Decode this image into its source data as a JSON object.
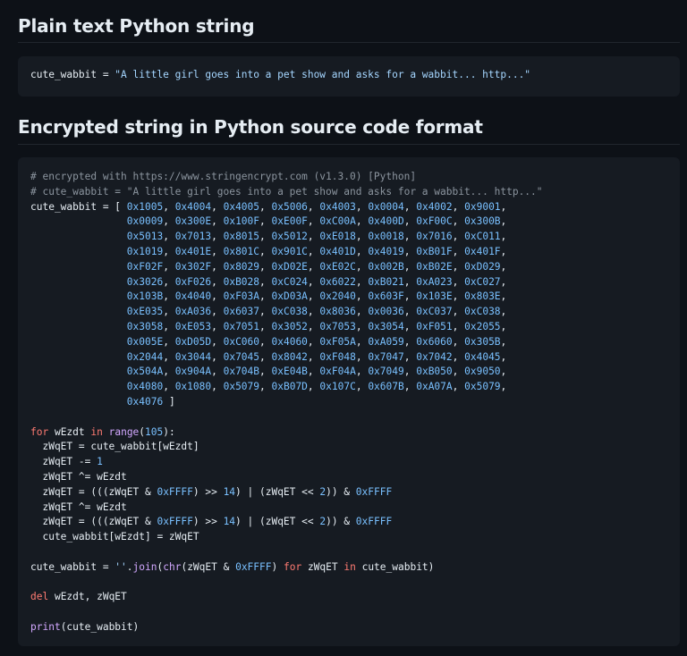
{
  "sections": [
    {
      "title": "Plain text Python string",
      "code_lines": [
        [
          {
            "t": "cute_wabbit = "
          },
          {
            "t": "\"A little girl goes into a pet show and asks for a wabbit... http...\"",
            "c": "s"
          }
        ]
      ]
    },
    {
      "title": "Encrypted string in Python source code format",
      "code_lines": [
        [
          {
            "t": "# encrypted with https://www.stringencrypt.com (v1.3.0) [Python]",
            "c": "c"
          }
        ],
        [
          {
            "t": "# cute_wabbit = \"A little girl goes into a pet show and asks for a wabbit... http...\"",
            "c": "c"
          }
        ],
        [
          {
            "t": "cute_wabbit = [ "
          },
          {
            "t": "0x1005",
            "c": "n"
          },
          {
            "t": ", "
          },
          {
            "t": "0x4004",
            "c": "n"
          },
          {
            "t": ", "
          },
          {
            "t": "0x4005",
            "c": "n"
          },
          {
            "t": ", "
          },
          {
            "t": "0x5006",
            "c": "n"
          },
          {
            "t": ", "
          },
          {
            "t": "0x4003",
            "c": "n"
          },
          {
            "t": ", "
          },
          {
            "t": "0x0004",
            "c": "n"
          },
          {
            "t": ", "
          },
          {
            "t": "0x4002",
            "c": "n"
          },
          {
            "t": ", "
          },
          {
            "t": "0x9001",
            "c": "n"
          },
          {
            "t": ","
          }
        ],
        [
          {
            "t": "                "
          },
          {
            "t": "0x0009",
            "c": "n"
          },
          {
            "t": ", "
          },
          {
            "t": "0x300E",
            "c": "n"
          },
          {
            "t": ", "
          },
          {
            "t": "0x100F",
            "c": "n"
          },
          {
            "t": ", "
          },
          {
            "t": "0xE00F",
            "c": "n"
          },
          {
            "t": ", "
          },
          {
            "t": "0xC00A",
            "c": "n"
          },
          {
            "t": ", "
          },
          {
            "t": "0x400D",
            "c": "n"
          },
          {
            "t": ", "
          },
          {
            "t": "0xF00C",
            "c": "n"
          },
          {
            "t": ", "
          },
          {
            "t": "0x300B",
            "c": "n"
          },
          {
            "t": ","
          }
        ],
        [
          {
            "t": "                "
          },
          {
            "t": "0x5013",
            "c": "n"
          },
          {
            "t": ", "
          },
          {
            "t": "0x7013",
            "c": "n"
          },
          {
            "t": ", "
          },
          {
            "t": "0x8015",
            "c": "n"
          },
          {
            "t": ", "
          },
          {
            "t": "0x5012",
            "c": "n"
          },
          {
            "t": ", "
          },
          {
            "t": "0xE018",
            "c": "n"
          },
          {
            "t": ", "
          },
          {
            "t": "0x0018",
            "c": "n"
          },
          {
            "t": ", "
          },
          {
            "t": "0x7016",
            "c": "n"
          },
          {
            "t": ", "
          },
          {
            "t": "0xC011",
            "c": "n"
          },
          {
            "t": ","
          }
        ],
        [
          {
            "t": "                "
          },
          {
            "t": "0x1019",
            "c": "n"
          },
          {
            "t": ", "
          },
          {
            "t": "0x401E",
            "c": "n"
          },
          {
            "t": ", "
          },
          {
            "t": "0x801C",
            "c": "n"
          },
          {
            "t": ", "
          },
          {
            "t": "0x901C",
            "c": "n"
          },
          {
            "t": ", "
          },
          {
            "t": "0x401D",
            "c": "n"
          },
          {
            "t": ", "
          },
          {
            "t": "0x4019",
            "c": "n"
          },
          {
            "t": ", "
          },
          {
            "t": "0xB01F",
            "c": "n"
          },
          {
            "t": ", "
          },
          {
            "t": "0x401F",
            "c": "n"
          },
          {
            "t": ","
          }
        ],
        [
          {
            "t": "                "
          },
          {
            "t": "0xF02F",
            "c": "n"
          },
          {
            "t": ", "
          },
          {
            "t": "0x302F",
            "c": "n"
          },
          {
            "t": ", "
          },
          {
            "t": "0x8029",
            "c": "n"
          },
          {
            "t": ", "
          },
          {
            "t": "0xD02E",
            "c": "n"
          },
          {
            "t": ", "
          },
          {
            "t": "0xE02C",
            "c": "n"
          },
          {
            "t": ", "
          },
          {
            "t": "0x002B",
            "c": "n"
          },
          {
            "t": ", "
          },
          {
            "t": "0xB02E",
            "c": "n"
          },
          {
            "t": ", "
          },
          {
            "t": "0xD029",
            "c": "n"
          },
          {
            "t": ","
          }
        ],
        [
          {
            "t": "                "
          },
          {
            "t": "0x3026",
            "c": "n"
          },
          {
            "t": ", "
          },
          {
            "t": "0xF026",
            "c": "n"
          },
          {
            "t": ", "
          },
          {
            "t": "0xB028",
            "c": "n"
          },
          {
            "t": ", "
          },
          {
            "t": "0xC024",
            "c": "n"
          },
          {
            "t": ", "
          },
          {
            "t": "0x6022",
            "c": "n"
          },
          {
            "t": ", "
          },
          {
            "t": "0xB021",
            "c": "n"
          },
          {
            "t": ", "
          },
          {
            "t": "0xA023",
            "c": "n"
          },
          {
            "t": ", "
          },
          {
            "t": "0xC027",
            "c": "n"
          },
          {
            "t": ","
          }
        ],
        [
          {
            "t": "                "
          },
          {
            "t": "0x103B",
            "c": "n"
          },
          {
            "t": ", "
          },
          {
            "t": "0x4040",
            "c": "n"
          },
          {
            "t": ", "
          },
          {
            "t": "0xF03A",
            "c": "n"
          },
          {
            "t": ", "
          },
          {
            "t": "0xD03A",
            "c": "n"
          },
          {
            "t": ", "
          },
          {
            "t": "0x2040",
            "c": "n"
          },
          {
            "t": ", "
          },
          {
            "t": "0x603F",
            "c": "n"
          },
          {
            "t": ", "
          },
          {
            "t": "0x103E",
            "c": "n"
          },
          {
            "t": ", "
          },
          {
            "t": "0x803E",
            "c": "n"
          },
          {
            "t": ","
          }
        ],
        [
          {
            "t": "                "
          },
          {
            "t": "0xE035",
            "c": "n"
          },
          {
            "t": ", "
          },
          {
            "t": "0xA036",
            "c": "n"
          },
          {
            "t": ", "
          },
          {
            "t": "0x6037",
            "c": "n"
          },
          {
            "t": ", "
          },
          {
            "t": "0xC038",
            "c": "n"
          },
          {
            "t": ", "
          },
          {
            "t": "0x8036",
            "c": "n"
          },
          {
            "t": ", "
          },
          {
            "t": "0x0036",
            "c": "n"
          },
          {
            "t": ", "
          },
          {
            "t": "0xC037",
            "c": "n"
          },
          {
            "t": ", "
          },
          {
            "t": "0xC038",
            "c": "n"
          },
          {
            "t": ","
          }
        ],
        [
          {
            "t": "                "
          },
          {
            "t": "0x3058",
            "c": "n"
          },
          {
            "t": ", "
          },
          {
            "t": "0xE053",
            "c": "n"
          },
          {
            "t": ", "
          },
          {
            "t": "0x7051",
            "c": "n"
          },
          {
            "t": ", "
          },
          {
            "t": "0x3052",
            "c": "n"
          },
          {
            "t": ", "
          },
          {
            "t": "0x7053",
            "c": "n"
          },
          {
            "t": ", "
          },
          {
            "t": "0x3054",
            "c": "n"
          },
          {
            "t": ", "
          },
          {
            "t": "0xF051",
            "c": "n"
          },
          {
            "t": ", "
          },
          {
            "t": "0x2055",
            "c": "n"
          },
          {
            "t": ","
          }
        ],
        [
          {
            "t": "                "
          },
          {
            "t": "0x005E",
            "c": "n"
          },
          {
            "t": ", "
          },
          {
            "t": "0xD05D",
            "c": "n"
          },
          {
            "t": ", "
          },
          {
            "t": "0xC060",
            "c": "n"
          },
          {
            "t": ", "
          },
          {
            "t": "0x4060",
            "c": "n"
          },
          {
            "t": ", "
          },
          {
            "t": "0xF05A",
            "c": "n"
          },
          {
            "t": ", "
          },
          {
            "t": "0xA059",
            "c": "n"
          },
          {
            "t": ", "
          },
          {
            "t": "0x6060",
            "c": "n"
          },
          {
            "t": ", "
          },
          {
            "t": "0x305B",
            "c": "n"
          },
          {
            "t": ","
          }
        ],
        [
          {
            "t": "                "
          },
          {
            "t": "0x2044",
            "c": "n"
          },
          {
            "t": ", "
          },
          {
            "t": "0x3044",
            "c": "n"
          },
          {
            "t": ", "
          },
          {
            "t": "0x7045",
            "c": "n"
          },
          {
            "t": ", "
          },
          {
            "t": "0x8042",
            "c": "n"
          },
          {
            "t": ", "
          },
          {
            "t": "0xF048",
            "c": "n"
          },
          {
            "t": ", "
          },
          {
            "t": "0x7047",
            "c": "n"
          },
          {
            "t": ", "
          },
          {
            "t": "0x7042",
            "c": "n"
          },
          {
            "t": ", "
          },
          {
            "t": "0x4045",
            "c": "n"
          },
          {
            "t": ","
          }
        ],
        [
          {
            "t": "                "
          },
          {
            "t": "0x504A",
            "c": "n"
          },
          {
            "t": ", "
          },
          {
            "t": "0x904A",
            "c": "n"
          },
          {
            "t": ", "
          },
          {
            "t": "0x704B",
            "c": "n"
          },
          {
            "t": ", "
          },
          {
            "t": "0xE04B",
            "c": "n"
          },
          {
            "t": ", "
          },
          {
            "t": "0xF04A",
            "c": "n"
          },
          {
            "t": ", "
          },
          {
            "t": "0x7049",
            "c": "n"
          },
          {
            "t": ", "
          },
          {
            "t": "0xB050",
            "c": "n"
          },
          {
            "t": ", "
          },
          {
            "t": "0x9050",
            "c": "n"
          },
          {
            "t": ","
          }
        ],
        [
          {
            "t": "                "
          },
          {
            "t": "0x4080",
            "c": "n"
          },
          {
            "t": ", "
          },
          {
            "t": "0x1080",
            "c": "n"
          },
          {
            "t": ", "
          },
          {
            "t": "0x5079",
            "c": "n"
          },
          {
            "t": ", "
          },
          {
            "t": "0xB07D",
            "c": "n"
          },
          {
            "t": ", "
          },
          {
            "t": "0x107C",
            "c": "n"
          },
          {
            "t": ", "
          },
          {
            "t": "0x607B",
            "c": "n"
          },
          {
            "t": ", "
          },
          {
            "t": "0xA07A",
            "c": "n"
          },
          {
            "t": ", "
          },
          {
            "t": "0x5079",
            "c": "n"
          },
          {
            "t": ","
          }
        ],
        [
          {
            "t": "                "
          },
          {
            "t": "0x4076",
            "c": "n"
          },
          {
            "t": " ]"
          }
        ],
        [],
        [
          {
            "t": "for",
            "c": "k"
          },
          {
            "t": " wEzdt "
          },
          {
            "t": "in",
            "c": "k"
          },
          {
            "t": " "
          },
          {
            "t": "range",
            "c": "b"
          },
          {
            "t": "("
          },
          {
            "t": "105",
            "c": "n"
          },
          {
            "t": "):"
          }
        ],
        [
          {
            "t": "  zWqET = cute_wabbit[wEzdt]"
          }
        ],
        [
          {
            "t": "  zWqET -= "
          },
          {
            "t": "1",
            "c": "n"
          }
        ],
        [
          {
            "t": "  zWqET ^= wEzdt"
          }
        ],
        [
          {
            "t": "  zWqET = (((zWqET & "
          },
          {
            "t": "0xFFFF",
            "c": "n"
          },
          {
            "t": ") >> "
          },
          {
            "t": "14",
            "c": "n"
          },
          {
            "t": ") | (zWqET << "
          },
          {
            "t": "2",
            "c": "n"
          },
          {
            "t": ")) & "
          },
          {
            "t": "0xFFFF",
            "c": "n"
          }
        ],
        [
          {
            "t": "  zWqET ^= wEzdt"
          }
        ],
        [
          {
            "t": "  zWqET = (((zWqET & "
          },
          {
            "t": "0xFFFF",
            "c": "n"
          },
          {
            "t": ") >> "
          },
          {
            "t": "14",
            "c": "n"
          },
          {
            "t": ") | (zWqET << "
          },
          {
            "t": "2",
            "c": "n"
          },
          {
            "t": ")) & "
          },
          {
            "t": "0xFFFF",
            "c": "n"
          }
        ],
        [
          {
            "t": "  cute_wabbit[wEzdt] = zWqET"
          }
        ],
        [],
        [
          {
            "t": "cute_wabbit = "
          },
          {
            "t": "''",
            "c": "s"
          },
          {
            "t": "."
          },
          {
            "t": "join",
            "c": "b"
          },
          {
            "t": "("
          },
          {
            "t": "chr",
            "c": "b"
          },
          {
            "t": "(zWqET & "
          },
          {
            "t": "0xFFFF",
            "c": "n"
          },
          {
            "t": ") "
          },
          {
            "t": "for",
            "c": "k"
          },
          {
            "t": " zWqET "
          },
          {
            "t": "in",
            "c": "k"
          },
          {
            "t": " cute_wabbit)"
          }
        ],
        [],
        [
          {
            "t": "del",
            "c": "k"
          },
          {
            "t": " wEzdt, zWqET"
          }
        ],
        [],
        [
          {
            "t": "print",
            "c": "b"
          },
          {
            "t": "(cute_wabbit)"
          }
        ]
      ]
    }
  ]
}
